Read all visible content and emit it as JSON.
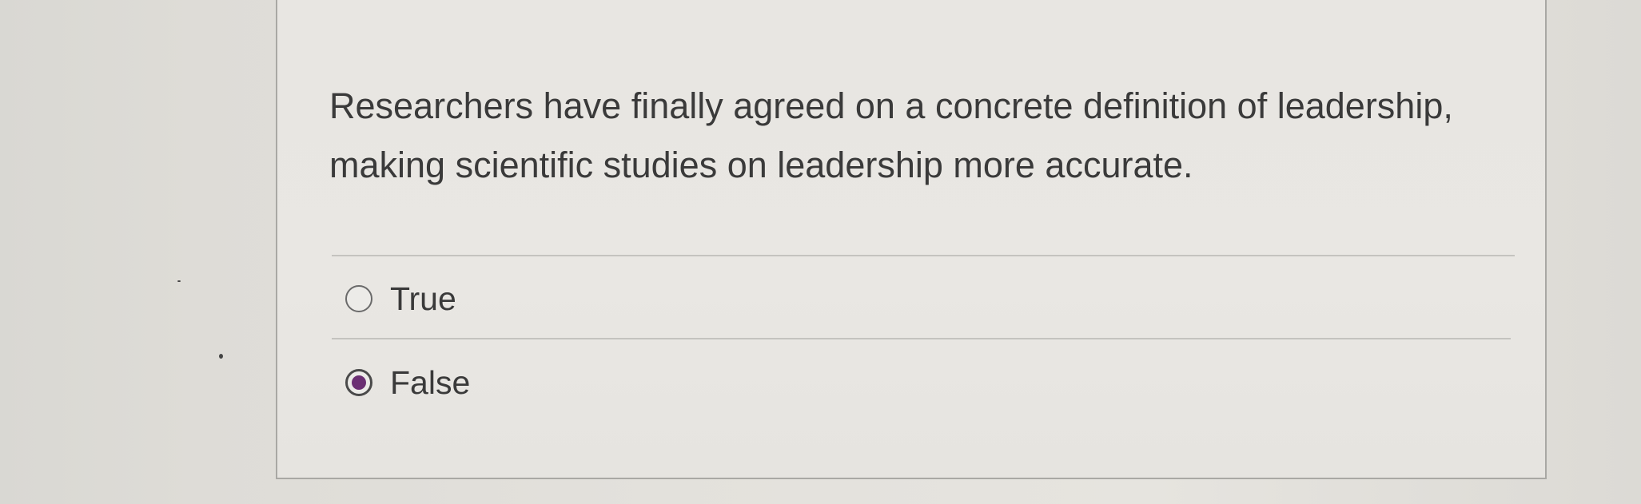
{
  "question": {
    "text": "Researchers have finally agreed on a concrete definition of leadership, making scientific studies on leadership more accurate."
  },
  "answers": [
    {
      "label": "True",
      "selected": false
    },
    {
      "label": "False",
      "selected": true
    }
  ],
  "colors": {
    "accent": "#6b2f73",
    "border": "#a9a8a4",
    "text": "#3a3a3a"
  }
}
